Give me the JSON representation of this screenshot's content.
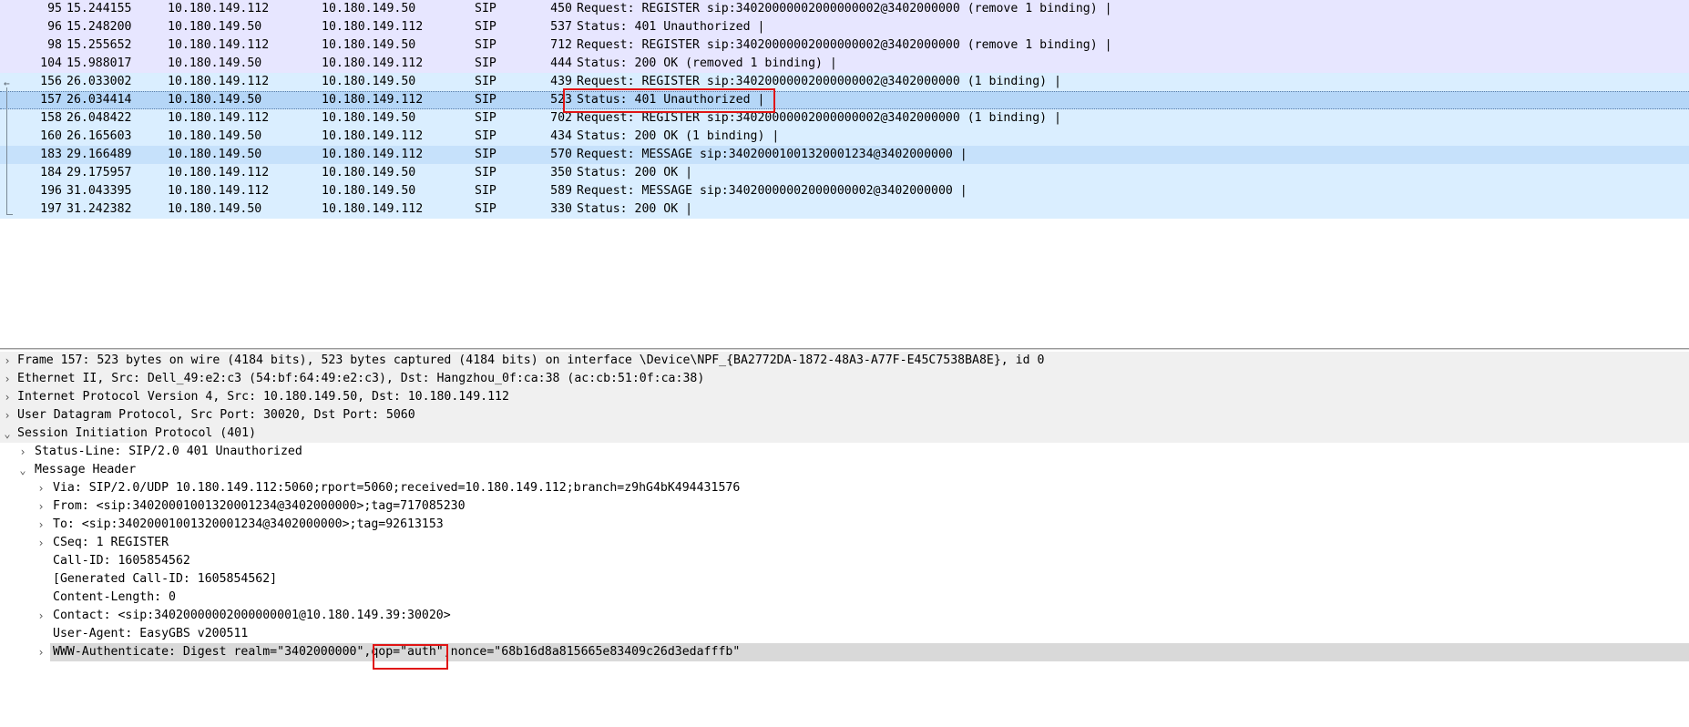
{
  "packets": [
    {
      "no": "95",
      "time": "15.244155",
      "src": "10.180.149.112",
      "dst": "10.180.149.50",
      "proto": "SIP",
      "len": "450",
      "info": "Request: REGISTER sip:34020000002000000002@3402000000  (remove 1 binding) |"
    },
    {
      "no": "96",
      "time": "15.248200",
      "src": "10.180.149.50",
      "dst": "10.180.149.112",
      "proto": "SIP",
      "len": "537",
      "info": "Status: 401 Unauthorized |"
    },
    {
      "no": "98",
      "time": "15.255652",
      "src": "10.180.149.112",
      "dst": "10.180.149.50",
      "proto": "SIP",
      "len": "712",
      "info": "Request: REGISTER sip:34020000002000000002@3402000000  (remove 1 binding) |"
    },
    {
      "no": "104",
      "time": "15.988017",
      "src": "10.180.149.50",
      "dst": "10.180.149.112",
      "proto": "SIP",
      "len": "444",
      "info": "Status: 200 OK  (removed 1 binding) |"
    },
    {
      "no": "156",
      "time": "26.033002",
      "src": "10.180.149.112",
      "dst": "10.180.149.50",
      "proto": "SIP",
      "len": "439",
      "info": "Request: REGISTER sip:34020000002000000002@3402000000  (1 binding) |"
    },
    {
      "no": "157",
      "time": "26.034414",
      "src": "10.180.149.50",
      "dst": "10.180.149.112",
      "proto": "SIP",
      "len": "523",
      "info": "Status: 401 Unauthorized |"
    },
    {
      "no": "158",
      "time": "26.048422",
      "src": "10.180.149.112",
      "dst": "10.180.149.50",
      "proto": "SIP",
      "len": "702",
      "info": "Request: REGISTER sip:34020000002000000002@3402000000  (1 binding) |"
    },
    {
      "no": "160",
      "time": "26.165603",
      "src": "10.180.149.50",
      "dst": "10.180.149.112",
      "proto": "SIP",
      "len": "434",
      "info": "Status: 200 OK  (1 binding) |"
    },
    {
      "no": "183",
      "time": "29.166489",
      "src": "10.180.149.50",
      "dst": "10.180.149.112",
      "proto": "SIP",
      "len": "570",
      "info": "Request: MESSAGE sip:34020001001320001234@3402000000 |"
    },
    {
      "no": "184",
      "time": "29.175957",
      "src": "10.180.149.112",
      "dst": "10.180.149.50",
      "proto": "SIP",
      "len": "350",
      "info": "Status: 200 OK |"
    },
    {
      "no": "196",
      "time": "31.043395",
      "src": "10.180.149.112",
      "dst": "10.180.149.50",
      "proto": "SIP",
      "len": "589",
      "info": "Request: MESSAGE sip:34020000002000000002@3402000000 |"
    },
    {
      "no": "197",
      "time": "31.242382",
      "src": "10.180.149.50",
      "dst": "10.180.149.112",
      "proto": "SIP",
      "len": "330",
      "info": "Status: 200 OK |"
    }
  ],
  "details": {
    "frame": "Frame 157: 523 bytes on wire (4184 bits), 523 bytes captured (4184 bits) on interface \\Device\\NPF_{BA2772DA-1872-48A3-A77F-E45C7538BA8E}, id 0",
    "ethernet": "Ethernet II, Src: Dell_49:e2:c3 (54:bf:64:49:e2:c3), Dst: Hangzhou_0f:ca:38 (ac:cb:51:0f:ca:38)",
    "ip": "Internet Protocol Version 4, Src: 10.180.149.50, Dst: 10.180.149.112",
    "udp": "User Datagram Protocol, Src Port: 30020, Dst Port: 5060",
    "sip": "Session Initiation Protocol (401)",
    "status_line": "Status-Line: SIP/2.0 401 Unauthorized",
    "message_header": "Message Header",
    "via": "Via: SIP/2.0/UDP 10.180.149.112:5060;rport=5060;received=10.180.149.112;branch=z9hG4bK494431576",
    "from": "From: <sip:34020001001320001234@3402000000>;tag=717085230",
    "to": "To: <sip:34020001001320001234@3402000000>;tag=92613153",
    "cseq": "CSeq: 1 REGISTER",
    "call_id": "Call-ID: 1605854562",
    "gen_call_id": "[Generated Call-ID: 1605854562]",
    "content_length": "Content-Length: 0",
    "contact": "Contact: <sip:34020000002000000001@10.180.149.39:30020>",
    "user_agent": "User-Agent: EasyGBS v200511",
    "www_auth": "WWW-Authenticate: Digest realm=\"3402000000\",qop=\"auth\",nonce=\"68b16d8a815665e83409c26d3edafffb\""
  },
  "colors": {
    "row_purple": "#e7e6ff",
    "row_blue": "#daeeff",
    "row_selected": "#b5d6f7",
    "annotation_red": "#e01515"
  },
  "icons": {
    "collapsed": "chevron-right-icon",
    "expanded": "chevron-down-icon"
  }
}
